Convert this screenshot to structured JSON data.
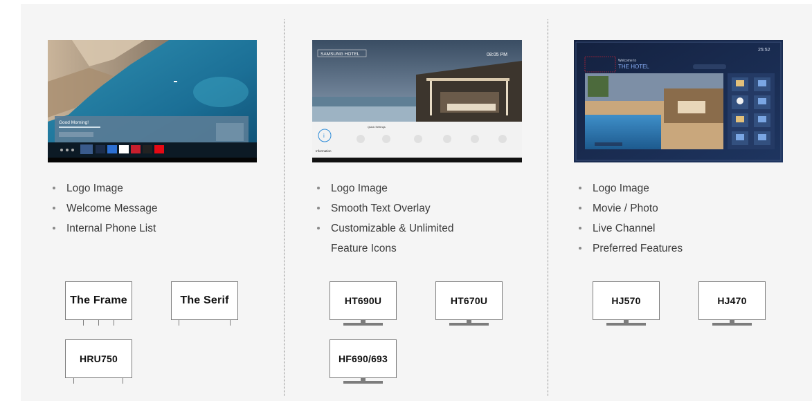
{
  "columns": [
    {
      "screen_text": [
        "Good Morning!"
      ],
      "bullets": [
        "Logo Image",
        "Welcome Message",
        "Internal Phone List"
      ],
      "models": [
        "The Frame",
        "The Serif",
        "HRU750"
      ]
    },
    {
      "screen_text": [
        "SAMSUNG HOTEL",
        "08:05 PM",
        "Quick Settings",
        "Information"
      ],
      "bullets": [
        "Logo Image",
        "Smooth Text Overlay",
        "Customizable & Unlimited",
        "Feature Icons"
      ],
      "models": [
        "HT690U",
        "HT670U",
        "HF690/693"
      ]
    },
    {
      "screen_text": [
        "Welcome to",
        "THE HOTEL",
        "25:52"
      ],
      "bullets": [
        "Logo Image",
        "Movie / Photo",
        "Live Channel",
        "Preferred Features"
      ],
      "models": [
        "HJ570",
        "HJ470"
      ]
    }
  ],
  "colors": {
    "panel": "#f5f5f5",
    "text": "#3c3c3c",
    "outline": "#7c7c7c"
  }
}
